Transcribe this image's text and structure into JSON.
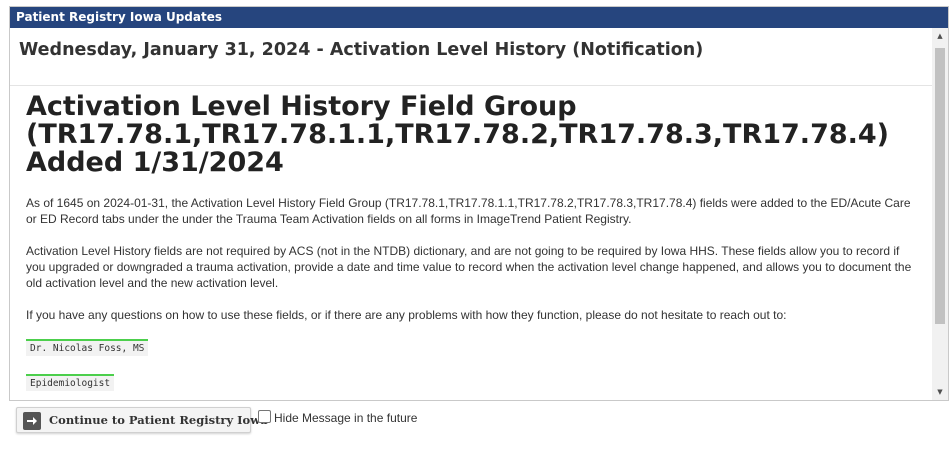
{
  "dialog": {
    "title": "Patient Registry Iowa Updates",
    "notice_date_title": "Wednesday, January 31, 2024 - Activation Level History (Notification)"
  },
  "article": {
    "heading": "Activation Level History Field Group (TR17.78.1,TR17.78.1.1,TR17.78.2,TR17.78.3,TR17.78.4) Added 1/31/2024",
    "paragraph_1": "As of 1645 on 2024-01-31, the Activation Level History Field Group (TR17.78.1,TR17.78.1.1,TR17.78.2,TR17.78.3,TR17.78.4) fields were added to the ED/Acute Care or ED Record tabs under the under the Trauma Team Activation fields on all forms in ImageTrend Patient Registry.",
    "paragraph_2": "Activation Level History fields are not required by ACS (not in the NTDB) dictionary, and are not going to be required by Iowa HHS.  These fields allow you to record if you upgraded or downgraded a trauma activation, provide a date and time value to record when the activation level change happened, and allows you to document the old activation level and the new activation level.",
    "paragraph_3": "If you have any questions on how to use these fields, or if there are any problems with how they function, please do not hesitate to reach out to:",
    "contact_name": "Dr. Nicolas Foss, MS",
    "contact_role": "Epidemiologist"
  },
  "footer": {
    "continue_label": "Continue to Patient Registry Iowa",
    "hide_message_label": "Hide Message in the future",
    "hide_message_checked": false
  },
  "icons": {
    "continue_icon": "arrow-right-icon",
    "scroll_up": "chevron-up-icon",
    "scroll_down": "chevron-down-icon"
  },
  "colors": {
    "titlebar": "#26457e",
    "tag_accent": "#4ccf4c"
  }
}
